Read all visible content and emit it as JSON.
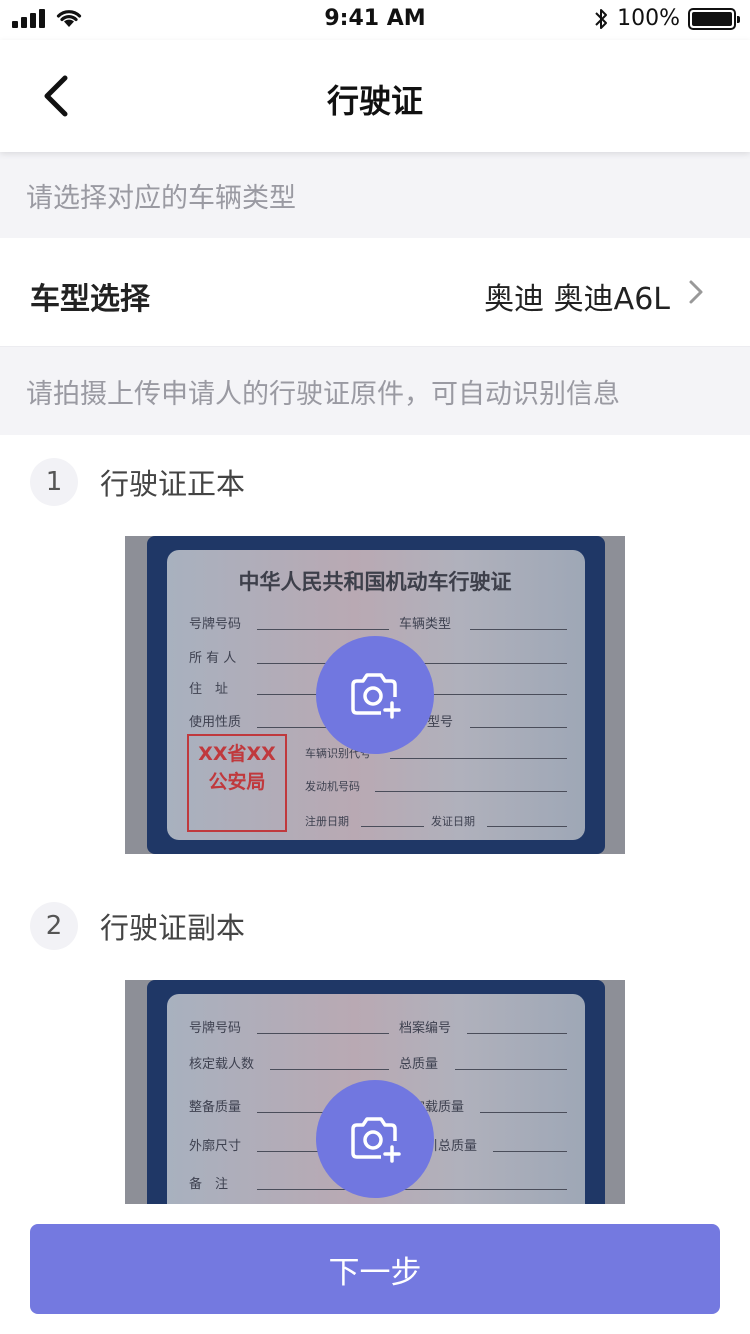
{
  "status_bar": {
    "time": "9:41 AM",
    "battery": "100%"
  },
  "nav": {
    "title": "行驶证"
  },
  "section1": {
    "hint": "请选择对应的车辆类型"
  },
  "vehicle_select": {
    "label": "车型选择",
    "value": "奥迪 奥迪A6L"
  },
  "section2": {
    "hint": "请拍摄上传申请人的行驶证原件，可自动识别信息"
  },
  "steps": [
    {
      "num": "1",
      "name": "行驶证正本"
    },
    {
      "num": "2",
      "name": "行驶证副本"
    }
  ],
  "card_front": {
    "title": "中华人民共和国机动车行驶证",
    "fields": [
      "号牌号码",
      "车辆类型",
      "所 有 人",
      "住　址",
      "使用性质",
      "品牌型号",
      "车辆识别代号",
      "发动机号码",
      "注册日期",
      "发证日期"
    ],
    "seal": [
      "XX省XX",
      "公安局"
    ]
  },
  "card_back": {
    "fields": [
      "号牌号码",
      "档案编号",
      "核定载人数",
      "总质量",
      "整备质量",
      "核定载质量",
      "外廓尺寸",
      "准牵引总质量",
      "备　注"
    ]
  },
  "footer": {
    "next_label": "下一步"
  },
  "colors": {
    "accent": "#7479e0",
    "hint_bg": "#f4f4f7",
    "card_frame": "#1f3766",
    "seal": "#c0393d"
  },
  "icons": {
    "back": "chevron-left-icon",
    "arrow": "chevron-right-icon",
    "camera": "camera-plus-icon"
  }
}
